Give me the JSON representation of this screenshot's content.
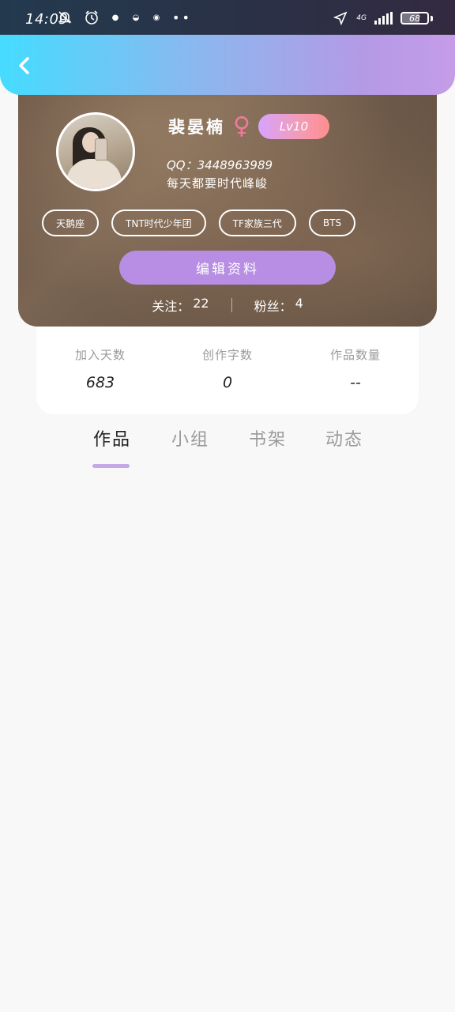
{
  "status_bar": {
    "time": "14:09",
    "network_type": "4G",
    "battery_level": "68",
    "battery_fraction": 0.68,
    "icons": [
      "mute-bell-icon",
      "alarm-icon",
      "app-notification-icon",
      "chat-icon",
      "app-icon",
      "more-dots-icon",
      "location-arrow-icon",
      "signal-icon",
      "battery-icon"
    ]
  },
  "header": {
    "back_icon": "chevron-left-icon",
    "gradient_colors": [
      "#45dcff",
      "#b49ae6"
    ]
  },
  "profile": {
    "name": "裴晏楠",
    "gender_symbol": "♀",
    "gender_color": "#f07a9a",
    "level": "Lv10",
    "qq": "QQ：3448963989",
    "motto": "每天都要时代峰峻",
    "tags": [
      "天鹅座",
      "TNT时代少年团",
      "TF家族三代",
      "BTS"
    ],
    "edit_button": "编辑资料",
    "following": {
      "label": "关注：",
      "value": "22"
    },
    "followers": {
      "label": "粉丝：",
      "value": "4"
    }
  },
  "stats": [
    {
      "label": "加入天数",
      "value": "683"
    },
    {
      "label": "创作字数",
      "value": "0"
    },
    {
      "label": "作品数量",
      "value": "--"
    }
  ],
  "tabs": [
    {
      "label": "作品",
      "active": true
    },
    {
      "label": "小组",
      "active": false
    },
    {
      "label": "书架",
      "active": false
    },
    {
      "label": "动态",
      "active": false
    }
  ],
  "colors": {
    "accent": "#b78ee3",
    "tab_indicator": "#c5a8e6",
    "page_background": "#f8f8f8"
  }
}
